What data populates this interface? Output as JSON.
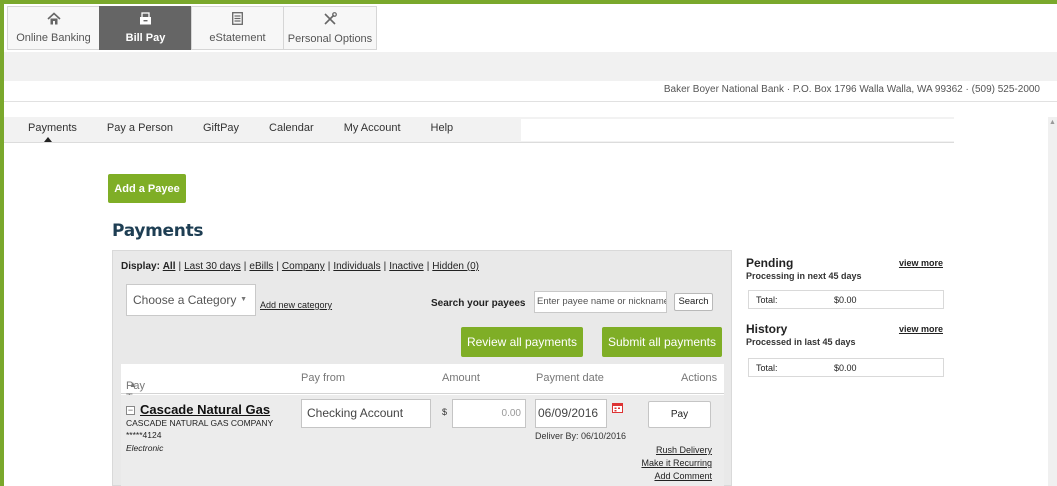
{
  "top_nav": {
    "tabs": [
      {
        "label": "Online Banking",
        "icon": "home-icon",
        "active": false
      },
      {
        "label": "Bill Pay",
        "icon": "bill-pay-icon",
        "active": true
      },
      {
        "label": "eStatement",
        "icon": "document-icon",
        "active": false
      },
      {
        "label": "Personal Options",
        "icon": "tools-icon",
        "active": false
      }
    ]
  },
  "bank_info": "Baker Boyer National Bank · P.O. Box 1796 Walla Walla, WA 99362 · (509) 525-2000",
  "sub_nav": {
    "items": [
      "Payments",
      "Pay a Person",
      "GiftPay",
      "Calendar",
      "My Account",
      "Help"
    ],
    "active": "Payments"
  },
  "add_payee_label": "Add a Payee",
  "page_title": "Payments",
  "filters": {
    "label": "Display:",
    "options": [
      "All",
      "Last 30 days",
      "eBills",
      "Company",
      "Individuals",
      "Inactive",
      "Hidden (0)"
    ],
    "active": "All"
  },
  "category": {
    "selected": "Choose a Category",
    "add_link": "Add new category"
  },
  "search": {
    "label": "Search your payees",
    "placeholder": "Enter payee name or nickname",
    "button": "Search"
  },
  "actions": {
    "review": "Review all payments",
    "submit": "Submit all payments"
  },
  "table": {
    "headers": {
      "pay_to": "Pay To",
      "pay_from": "Pay from",
      "amount": "Amount",
      "payment_date": "Payment date",
      "actions": "Actions"
    },
    "rows": [
      {
        "payee_name": "Cascade Natural Gas",
        "company": "CASCADE NATURAL GAS COMPANY",
        "account": "*****4124",
        "type": "Electronic",
        "pay_from": "Checking Account",
        "currency": "$",
        "amount_placeholder": "0.00",
        "payment_date": "06/09/2016",
        "deliver_by": "Deliver By: 06/10/2016",
        "pay_button": "Pay",
        "links": [
          "Rush Delivery",
          "Make it Recurring",
          "Add Comment"
        ]
      }
    ]
  },
  "pending": {
    "title": "Pending",
    "subtitle": "Processing in next 45 days",
    "view_more": "view more",
    "total_label": "Total:",
    "total_value": "$0.00"
  },
  "history": {
    "title": "History",
    "subtitle": "Processed in last 45 days",
    "view_more": "view more",
    "total_label": "Total:",
    "total_value": "$0.00"
  },
  "colors": {
    "accent_green": "#7fae26",
    "frame_green": "#7aa82c",
    "title_navy": "#1e3e53",
    "active_tab": "#656565"
  }
}
